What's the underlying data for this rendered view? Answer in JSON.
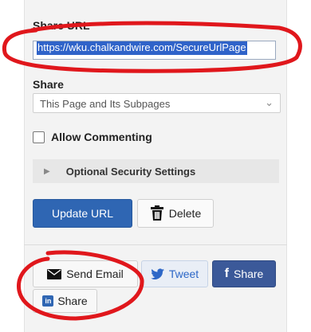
{
  "share_url": {
    "label": "Share URL",
    "value": "https://wku.chalkandwire.com/SecureUrlPage"
  },
  "share": {
    "label": "Share",
    "selected": "This Page and Its Subpages"
  },
  "allow_commenting": {
    "label": "Allow Commenting",
    "checked": false
  },
  "security": {
    "label": "Optional Security Settings"
  },
  "actions": {
    "update_label": "Update URL",
    "delete_label": "Delete"
  },
  "social": {
    "email_label": "Send Email",
    "tweet_label": "Tweet",
    "facebook_label": "Share",
    "linkedin_label": "Share"
  },
  "colors": {
    "primary": "#2f66b3",
    "annotation": "#e0171c",
    "facebook": "#3b5999",
    "twitter": "#2d67c7"
  },
  "icons": [
    "trash-icon",
    "envelope-icon",
    "twitter-bird-icon",
    "facebook-icon",
    "linkedin-icon",
    "caret-right-icon",
    "chevron-down-icon"
  ]
}
